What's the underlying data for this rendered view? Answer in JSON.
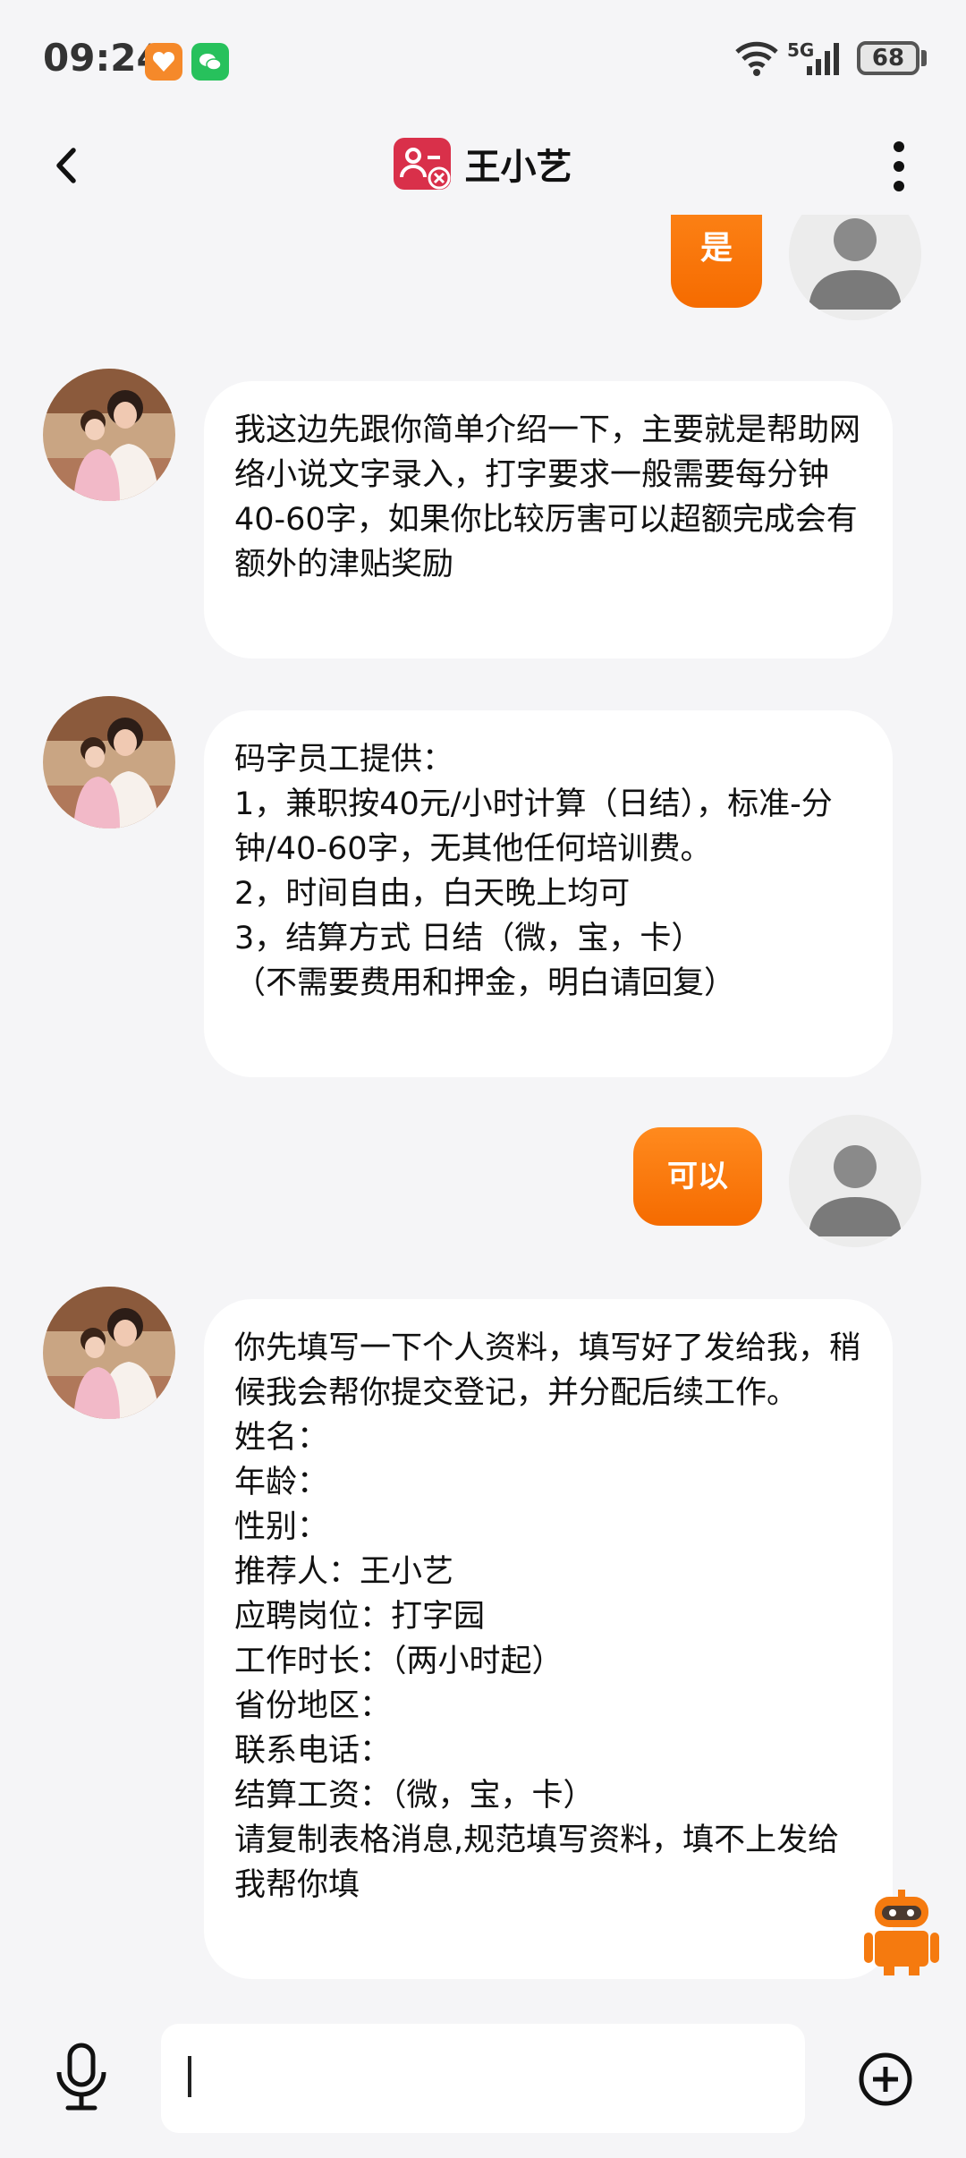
{
  "status_bar": {
    "time": "09:24",
    "network": "5G",
    "battery": "68"
  },
  "header": {
    "title": "王小艺"
  },
  "messages": [
    {
      "from": "me",
      "text": "是"
    },
    {
      "from": "them",
      "text": "我这边先跟你简单介绍一下，主要就是帮助网络小说文字录入，打字要求一般需要每分钟40-60字，如果你比较厉害可以超额完成会有额外的津贴奖励"
    },
    {
      "from": "them",
      "text": "码字员工提供：\n1，兼职按40元/小时计算（日结），标准-分钟/40-60字，无其他任何培训费。\n2，时间自由，白天晚上均可\n3，结算方式 日结（微，宝，卡）\n（不需要费用和押金，明白请回复）"
    },
    {
      "from": "me",
      "text": "可以"
    },
    {
      "from": "them",
      "text": "你先填写一下个人资料，填写好了发给我，稍候我会帮你提交登记，并分配后续工作。\n姓名：\n年龄：\n性别：\n推荐人：王小艺\n应聘岗位：打字园\n工作时长：（两小时起）\n省份地区：\n联系电话：\n结算工资：（微，宝，卡）\n请复制表格消息,规范填写资料，填不上发给我帮你填"
    }
  ],
  "input": {
    "value": ""
  },
  "colors": {
    "accent": "#f57a0f",
    "background": "#f5f5f7",
    "bubble_in": "#ffffff",
    "title_icon": "#d9304a"
  }
}
